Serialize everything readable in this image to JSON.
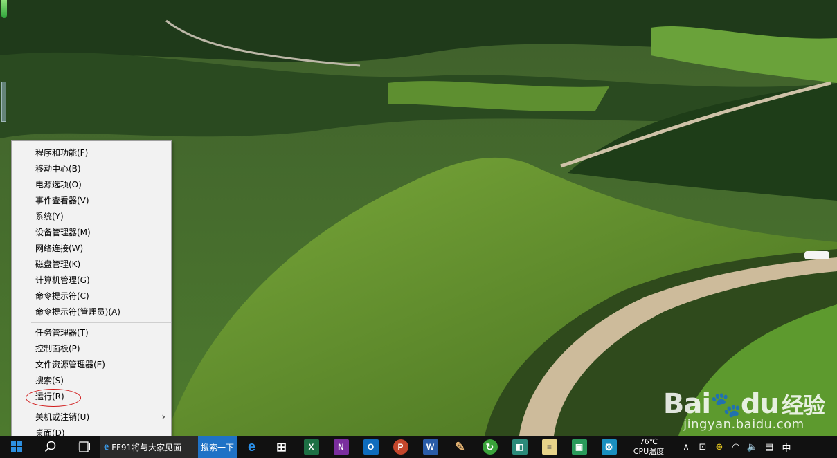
{
  "menu": {
    "group1": [
      {
        "label": "程序和功能(F)"
      },
      {
        "label": "移动中心(B)"
      },
      {
        "label": "电源选项(O)"
      },
      {
        "label": "事件查看器(V)"
      },
      {
        "label": "系统(Y)"
      },
      {
        "label": "设备管理器(M)"
      },
      {
        "label": "网络连接(W)"
      },
      {
        "label": "磁盘管理(K)"
      },
      {
        "label": "计算机管理(G)"
      },
      {
        "label": "命令提示符(C)"
      },
      {
        "label": "命令提示符(管理员)(A)"
      }
    ],
    "group2": [
      {
        "label": "任务管理器(T)"
      },
      {
        "label": "控制面板(P)"
      },
      {
        "label": "文件资源管理器(E)"
      },
      {
        "label": "搜索(S)"
      },
      {
        "label": "运行(R)"
      }
    ],
    "group3": [
      {
        "label": "关机或注销(U)",
        "submenu_arrow": "›"
      },
      {
        "label": "桌面(D)"
      }
    ]
  },
  "taskbar": {
    "window_title": "FF91将与大家见面",
    "search_tile": "搜索一下",
    "temperature": "76℃",
    "temperature_label": "CPU温度",
    "ime": "中",
    "apps": [
      {
        "icon": "edge-icon",
        "color": "#1e78d6",
        "glyph": "e"
      },
      {
        "icon": "store-icon",
        "color": "#ffffff",
        "glyph": "⊞"
      },
      {
        "icon": "excel-icon",
        "color": "#1d7044",
        "glyph": "X"
      },
      {
        "icon": "onenote-icon",
        "color": "#7a2e9e",
        "glyph": "N"
      },
      {
        "icon": "outlook-icon",
        "color": "#0f6cbd",
        "glyph": "O"
      },
      {
        "icon": "powerpoint-icon",
        "color": "#c4462b",
        "glyph": "P"
      },
      {
        "icon": "word-icon",
        "color": "#2a5ca8",
        "glyph": "W"
      },
      {
        "icon": "paint-icon",
        "color": "#c8a060",
        "glyph": "✎"
      },
      {
        "icon": "refresh-app-icon",
        "color": "#3aa23a",
        "glyph": "↻"
      },
      {
        "icon": "image-app-icon",
        "color": "#2c8a7a",
        "glyph": "◧"
      },
      {
        "icon": "notepad-icon",
        "color": "#e8d48a",
        "glyph": "≡"
      },
      {
        "icon": "photo-app-icon",
        "color": "#2a9a5a",
        "glyph": "▣"
      },
      {
        "icon": "settings-icon",
        "color": "#1a8fbf",
        "glyph": "⚙"
      }
    ]
  },
  "watermark": {
    "logo_left": "Bai",
    "logo_right": "du",
    "logo_cn": "经验",
    "url": "jingyan.baidu.com"
  },
  "colors": {
    "taskbar": "#111111",
    "menu_bg": "#f2f2f2",
    "highlight_ring": "#d01818",
    "search_tile": "#1f72c6"
  }
}
